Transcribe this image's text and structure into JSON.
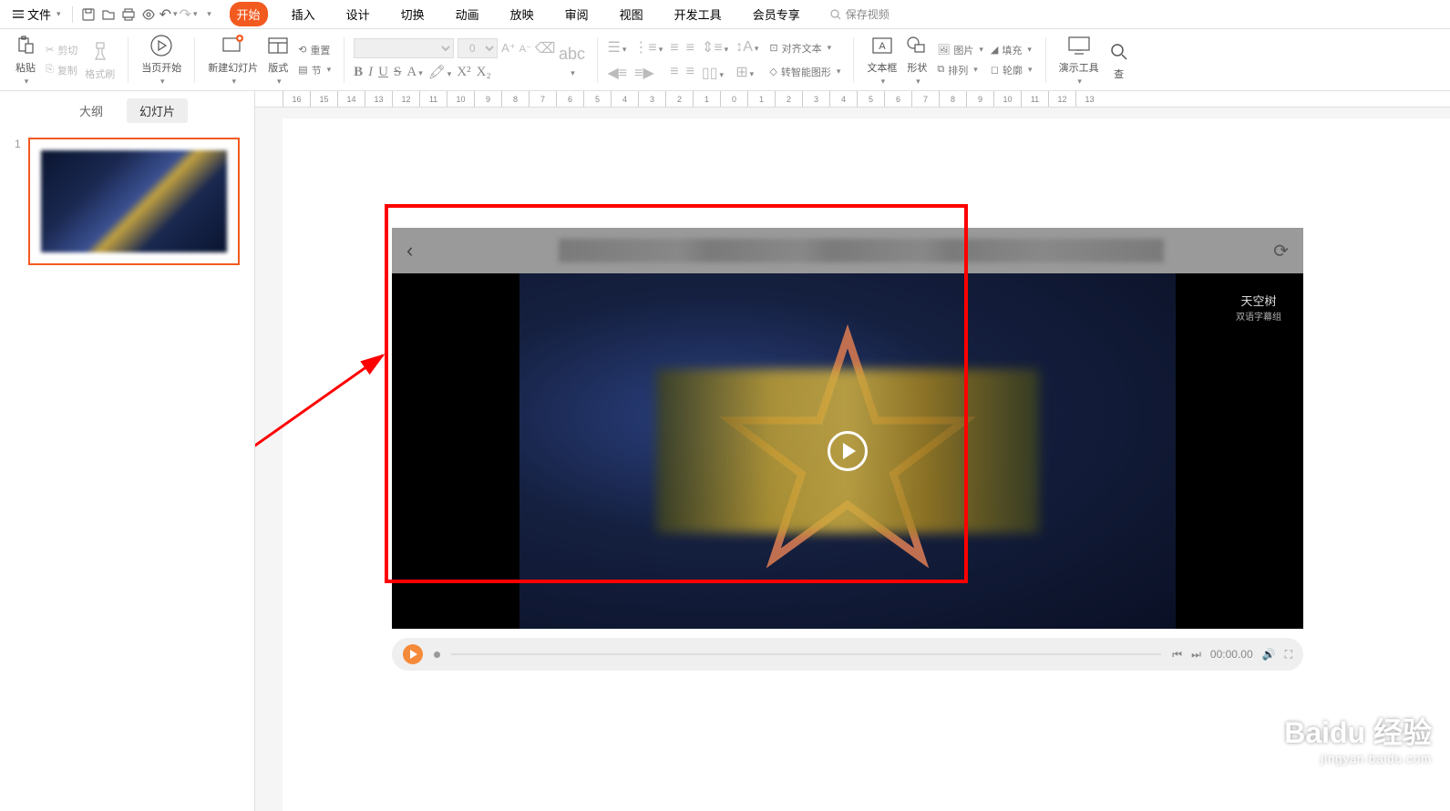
{
  "menubar": {
    "file": "文件",
    "tabs": [
      "开始",
      "插入",
      "设计",
      "切换",
      "动画",
      "放映",
      "审阅",
      "视图",
      "开发工具",
      "会员专享"
    ],
    "active_tab": 0,
    "save_video": "保存视频"
  },
  "ribbon": {
    "paste": "粘贴",
    "cut": "剪切",
    "copy": "复制",
    "format_painter": "格式刷",
    "from_current": "当页开始",
    "new_slide": "新建幻灯片",
    "layout": "版式",
    "section": "节",
    "reset": "重置",
    "font_size": "0",
    "text_box": "文本框",
    "shape": "形状",
    "align_text": "对齐文本",
    "smart_art": "转智能图形",
    "picture": "图片",
    "arrange": "排列",
    "fill": "填充",
    "outline": "轮廓",
    "present_tools": "演示工具",
    "find": "查"
  },
  "sidebar": {
    "tabs": [
      "大纲",
      "幻灯片"
    ],
    "active_tab": 1,
    "slide_num": "1"
  },
  "ruler_marks": [
    "16",
    "15",
    "14",
    "13",
    "12",
    "11",
    "10",
    "9",
    "8",
    "7",
    "6",
    "5",
    "4",
    "3",
    "2",
    "1",
    "0",
    "1",
    "2",
    "3",
    "4",
    "5",
    "6",
    "7",
    "8",
    "9",
    "10",
    "11",
    "12",
    "13"
  ],
  "video": {
    "watermark_top": "天空树",
    "watermark_sub": "双语字幕组"
  },
  "controls": {
    "time": "00:00.00"
  },
  "watermark": {
    "brand": "Baidu",
    "label": "经验",
    "url": "jingyan.baidu.com"
  }
}
